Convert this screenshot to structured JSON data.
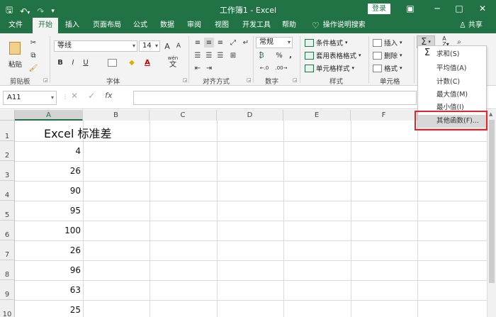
{
  "window": {
    "title": "工作簿1 - Excel",
    "login_label": "登录",
    "controls": [
      "▣",
      "─",
      "□",
      "✕"
    ]
  },
  "qat": {
    "save": "🖫",
    "undo": "↶",
    "undo_arrow": "▾",
    "redo": "↷",
    "customize": "▾"
  },
  "tabs": [
    "文件",
    "开始",
    "插入",
    "页面布局",
    "公式",
    "数据",
    "审阅",
    "视图",
    "开发工具",
    "帮助"
  ],
  "tabs_active_index": 1,
  "tell_me": "操作说明搜索",
  "share": "共享",
  "ribbon": {
    "clipboard": {
      "label": "剪贴板",
      "paste": "粘贴"
    },
    "font": {
      "label": "字体",
      "name": "等线",
      "size": "14",
      "grow": "A",
      "shrink": "A",
      "bold": "B",
      "italic": "I",
      "underline": "U",
      "wen": "wén",
      "wen_char": "文"
    },
    "alignment": {
      "label": "对齐方式"
    },
    "number": {
      "label": "数字",
      "format": "常规",
      "percent": "%",
      "comma": ","
    },
    "styles": {
      "label": "样式",
      "cond": "条件格式",
      "table": "套用表格格式",
      "cell": "单元格样式"
    },
    "cells": {
      "label": "单元格",
      "insert": "插入",
      "delete": "删除",
      "format": "格式"
    },
    "editing": {
      "sigma": "Σ"
    }
  },
  "formula_bar": {
    "name_box": "A11",
    "cancel": "✕",
    "enter": "✓",
    "fx": "fx",
    "value": ""
  },
  "grid": {
    "columns": [
      "A",
      "B",
      "C",
      "D",
      "E",
      "F"
    ],
    "rows": [
      "1",
      "2",
      "3",
      "4",
      "5",
      "6",
      "7",
      "8",
      "9",
      "10"
    ],
    "cells": {
      "A1": "Excel 标准差",
      "A2": "4",
      "A3": "26",
      "A4": "90",
      "A5": "95",
      "A6": "100",
      "A7": "26",
      "A8": "96",
      "A9": "63",
      "A10": "25"
    }
  },
  "autosum_menu": {
    "items": [
      "求和(S)",
      "平均值(A)",
      "计数(C)",
      "最大值(M)",
      "最小值(I)",
      "其他函数(F)..."
    ],
    "highlighted_index": 5
  }
}
